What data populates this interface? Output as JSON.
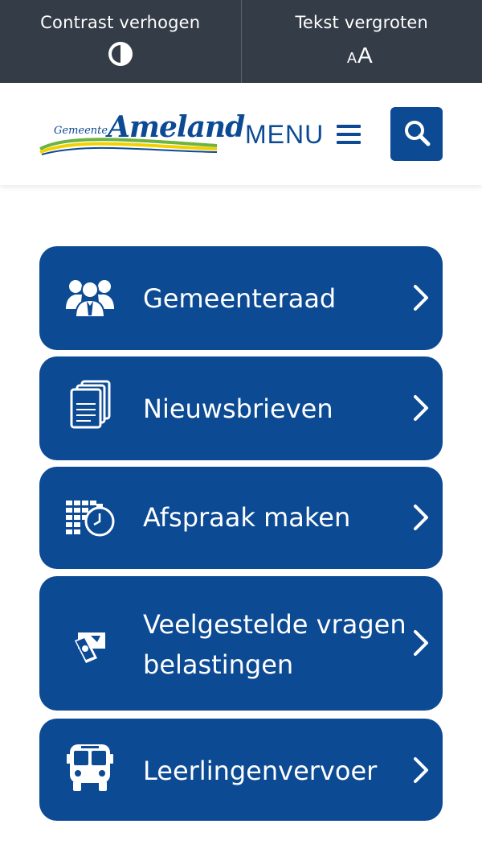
{
  "accessibility_bar": {
    "contrast": {
      "label": "Contrast verhogen",
      "icon": "contrast-icon"
    },
    "text_size": {
      "label": "Tekst vergroten",
      "icon": "text-size-icon"
    }
  },
  "header": {
    "logo": {
      "small_text": "Gemeente",
      "big_text": "Ameland"
    },
    "menu_label": "MENU",
    "menu_icon": "hamburger-icon",
    "search_icon": "search-icon"
  },
  "colors": {
    "primary": "#0c4a94",
    "top_bar": "#343c47",
    "background": "#ffffff"
  },
  "tiles": [
    {
      "label": "Gemeenteraad",
      "icon": "council-people-icon"
    },
    {
      "label": "Nieuwsbrieven",
      "icon": "documents-icon"
    },
    {
      "label": "Afspraak maken",
      "icon": "calendar-clock-icon"
    },
    {
      "label_lines": [
        "Veelgestelde vragen",
        "belastingen"
      ],
      "icon": "tax-money-icon"
    },
    {
      "label": "Leerlingenvervoer",
      "icon": "bus-icon"
    }
  ]
}
